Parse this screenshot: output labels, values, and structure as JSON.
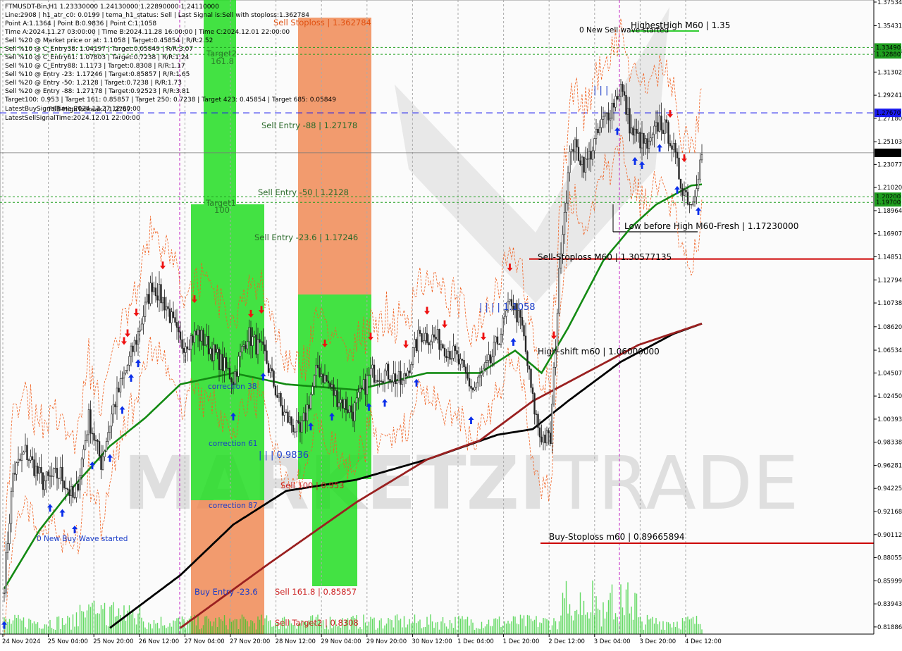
{
  "info_lines": [
    "FTMUSDT-Bin,H1  1.23330000 1.24130000 1.22890000 1.24110000",
    "Line:2908 | h1_atr_c0: 0.0199 | tema_h1_status: Sell | Last Signal is:Sell with stoploss:1.362784",
    "Point A:1.1364 | Point B:0.9836 | Point C:1.1058",
    "Time A:2024.11.27 03:00:00 | Time B:2024.11.28 16:00:00 | Time C:2024.12.01 22:00:00",
    "Sell %20 @ Market price or at: 1.1058 | Target:0.45854 | R/R:2.52",
    "Sell %10 @ C_Entry38: 1.04197 | Target:0.05849 | R/R:3.07",
    "Sell %10 @ C_Entry61: 1.07803 | Target:0.7238 | R/R:1.24",
    "Sell %10 @ C_Entry88: 1.1173 | Target:0.8308 | R/R:1.17",
    "Sell %10 @ Entry -23: 1.17246 | Target:0.85857 | R/R:1.65",
    "Sell %20 @ Entry -50: 1.2128 | Target:0.7238 | R/R:1.73",
    "Sell %20 @ Entry -88: 1.27178 | Target:0.92523 | R/R:3.81",
    "Target100: 0.953 | Target 161: 0.85857 | Target 250: 0.7238 | Target 423: 0.45854 | Target 685: 0.05849",
    "LatestBuySignalTime:2024.11.27 12:00:00",
    "LatestSellSignalTime:2024.12.01 22:00:00"
  ],
  "info_overlap_text": "FSB-HighToBreak | 1.2767",
  "watermark": {
    "left": "MARKETZI",
    "right": "TRADE"
  },
  "colors": {
    "green_zone": "#22dd22",
    "orange_zone": "#f08a55",
    "stoploss_line": "#cc0000",
    "blue_dash": "#1a1aee",
    "ma_green": "#138a13",
    "ma_black": "#000000",
    "ma_brown": "#9a2020",
    "candle": "#222222",
    "buy_arrow": "#0a2eea",
    "sell_arrow": "#ee1010"
  },
  "zone_labels": {
    "target2": "Target2",
    "target2_val": "161.8",
    "target1": "Target1",
    "target1_val": "100",
    "corr38": "correction 38",
    "corr61": "correction 61",
    "corr87": "correction 87",
    "buy_entry": "Buy Entry -23.6",
    "sell_stoploss": "Sell Stoploss | 1.362784",
    "sell_entry88": "Sell Entry -88 | 1.27178",
    "sell_entry50": "Sell Entry -50 | 1.2128",
    "sell_entry23": "Sell Entry -23.6 | 1.17246",
    "point_b": "| | | 0.9836",
    "point_c": "| | | | 1.1058",
    "sell100": "Sell 100 | 0.953",
    "sell161": "Sell 161.8 | 0.85857",
    "sell_target2": "Sell Target2 | 0.8308",
    "new_sell_wave": "0 New Sell wave started",
    "new_buy_wave": "0 New Buy Wave started",
    "highest_high": "HighestHigh   M60 | 1.35",
    "low_before_high": "Low before High   M60-Fresh | 1.17230000",
    "sell_stoploss_m60": "Sell-Stoploss M60 | 1.30577135",
    "high_shift": "High-shift m60 | 1.06000000",
    "buy_stoploss": "Buy-Stoploss m60 | 0.89665894",
    "top_marks": "| | |"
  },
  "price_tags": [
    {
      "label": "1.33490",
      "price": 1.3349,
      "color": "#1f9e1f"
    },
    {
      "label": "1.32880",
      "price": 1.3288,
      "color": "#1f9e1f"
    },
    {
      "label": "1.27670",
      "price": 1.2767,
      "color": "#1a1aee"
    },
    {
      "label": "1.24110",
      "price": 1.2411,
      "color": "#000000"
    },
    {
      "label": "1.20200",
      "price": 1.202,
      "color": "#1f9e1f"
    },
    {
      "label": "1.19700",
      "price": 1.197,
      "color": "#1f9e1f"
    }
  ],
  "chart_data": {
    "type": "candlestick",
    "symbol": "FTMUSDT-Bin,H1",
    "ylim": [
      0.8125,
      1.3772
    ],
    "y_ticks": [
      "1.37534",
      "1.35431",
      "1.33128",
      "1.31302",
      "1.29241",
      "1.27180",
      "1.25103",
      "1.23077",
      "1.21020",
      "1.18964",
      "1.16907",
      "1.14851",
      "1.12794",
      "1.10738",
      "1.08620",
      "1.06534",
      "1.04507",
      "1.02450",
      "1.00393",
      "0.98338",
      "0.96281",
      "0.94225",
      "0.92168",
      "0.90112",
      "0.88055",
      "0.85999",
      "0.83943",
      "0.81886"
    ],
    "x_ticks": [
      "24 Nov 2024",
      "25 Nov 04:00",
      "25 Nov 20:00",
      "26 Nov 12:00",
      "27 Nov 04:00",
      "27 Nov 20:00",
      "28 Nov 12:00",
      "29 Nov 04:00",
      "29 Nov 20:00",
      "30 Nov 12:00",
      "1 Dec 04:00",
      "1 Dec 20:00",
      "2 Dec 12:00",
      "3 Dec 04:00",
      "3 Dec 20:00",
      "4 Dec 12:00"
    ],
    "price_anchors": [
      [
        0,
        0.858
      ],
      [
        5,
        0.955
      ],
      [
        12,
        0.975
      ],
      [
        22,
        0.948
      ],
      [
        32,
        0.955
      ],
      [
        40,
        0.93
      ],
      [
        48,
        1.005
      ],
      [
        55,
        0.965
      ],
      [
        62,
        1.015
      ],
      [
        75,
        1.075
      ],
      [
        84,
        1.125
      ],
      [
        92,
        1.105
      ],
      [
        100,
        1.07
      ],
      [
        110,
        1.08
      ],
      [
        118,
        1.065
      ],
      [
        130,
        1.04
      ],
      [
        138,
        1.08
      ],
      [
        148,
        1.06
      ],
      [
        158,
        1.01
      ],
      [
        168,
        0.99
      ],
      [
        178,
        1.05
      ],
      [
        188,
        1.025
      ],
      [
        198,
        1.01
      ],
      [
        208,
        1.045
      ],
      [
        218,
        1.045
      ],
      [
        226,
        1.035
      ],
      [
        236,
        1.08
      ],
      [
        246,
        1.075
      ],
      [
        256,
        1.06
      ],
      [
        266,
        1.03
      ],
      [
        276,
        1.055
      ],
      [
        288,
        1.11
      ],
      [
        294,
        1.085
      ],
      [
        300,
        1.02
      ],
      [
        304,
        0.99
      ],
      [
        310,
        0.985
      ],
      [
        316,
        1.16
      ],
      [
        322,
        1.25
      ],
      [
        330,
        1.23
      ],
      [
        340,
        1.27
      ],
      [
        344,
        1.28
      ],
      [
        350,
        1.3
      ],
      [
        356,
        1.26
      ],
      [
        366,
        1.245
      ],
      [
        372,
        1.27
      ],
      [
        378,
        1.255
      ],
      [
        384,
        1.215
      ],
      [
        390,
        1.195
      ],
      [
        396,
        1.24
      ]
    ],
    "moving_averages": [
      {
        "name": "MA green",
        "points": [
          [
            0,
            0.853
          ],
          [
            20,
            0.905
          ],
          [
            40,
            0.945
          ],
          [
            60,
            0.98
          ],
          [
            80,
            1.005
          ],
          [
            100,
            1.035
          ],
          [
            130,
            1.045
          ],
          [
            160,
            1.035
          ],
          [
            200,
            1.03
          ],
          [
            240,
            1.045
          ],
          [
            270,
            1.045
          ],
          [
            290,
            1.065
          ],
          [
            305,
            1.045
          ],
          [
            320,
            1.085
          ],
          [
            340,
            1.145
          ],
          [
            356,
            1.175
          ],
          [
            370,
            1.195
          ],
          [
            390,
            1.212
          ],
          [
            396,
            1.213
          ]
        ]
      },
      {
        "name": "MA black",
        "points": [
          [
            60,
            0.818
          ],
          [
            100,
            0.865
          ],
          [
            130,
            0.91
          ],
          [
            160,
            0.94
          ],
          [
            200,
            0.95
          ],
          [
            240,
            0.968
          ],
          [
            280,
            0.99
          ],
          [
            300,
            0.995
          ],
          [
            320,
            1.02
          ],
          [
            350,
            1.055
          ],
          [
            380,
            1.08
          ],
          [
            396,
            1.089
          ]
        ]
      },
      {
        "name": "MA brown",
        "points": [
          [
            100,
            0.818
          ],
          [
            150,
            0.875
          ],
          [
            200,
            0.93
          ],
          [
            240,
            0.968
          ],
          [
            270,
            0.985
          ],
          [
            300,
            1.02
          ],
          [
            330,
            1.045
          ],
          [
            360,
            1.07
          ],
          [
            396,
            1.089
          ]
        ]
      }
    ],
    "levels": [
      {
        "name": "FSB-HighToBreak",
        "price": 1.2767,
        "style": "dashed"
      },
      {
        "name": "Sell-Stoploss M60",
        "price": 1.30577135,
        "style": "solid"
      },
      {
        "name": "Buy-Stoploss m60",
        "price": 0.89665894,
        "style": "solid"
      },
      {
        "name": "HighestHigh M60",
        "price": 1.35,
        "style": "solid"
      },
      {
        "name": "Low before High M60-Fresh",
        "price": 1.1723,
        "style": "solid"
      },
      {
        "name": "High-shift m60",
        "price": 1.06,
        "style": "solid"
      },
      {
        "name": "Current price",
        "price": 1.2411,
        "style": "solid"
      }
    ],
    "points": {
      "A": 1.1364,
      "B": 0.9836,
      "C": 1.1058
    }
  }
}
